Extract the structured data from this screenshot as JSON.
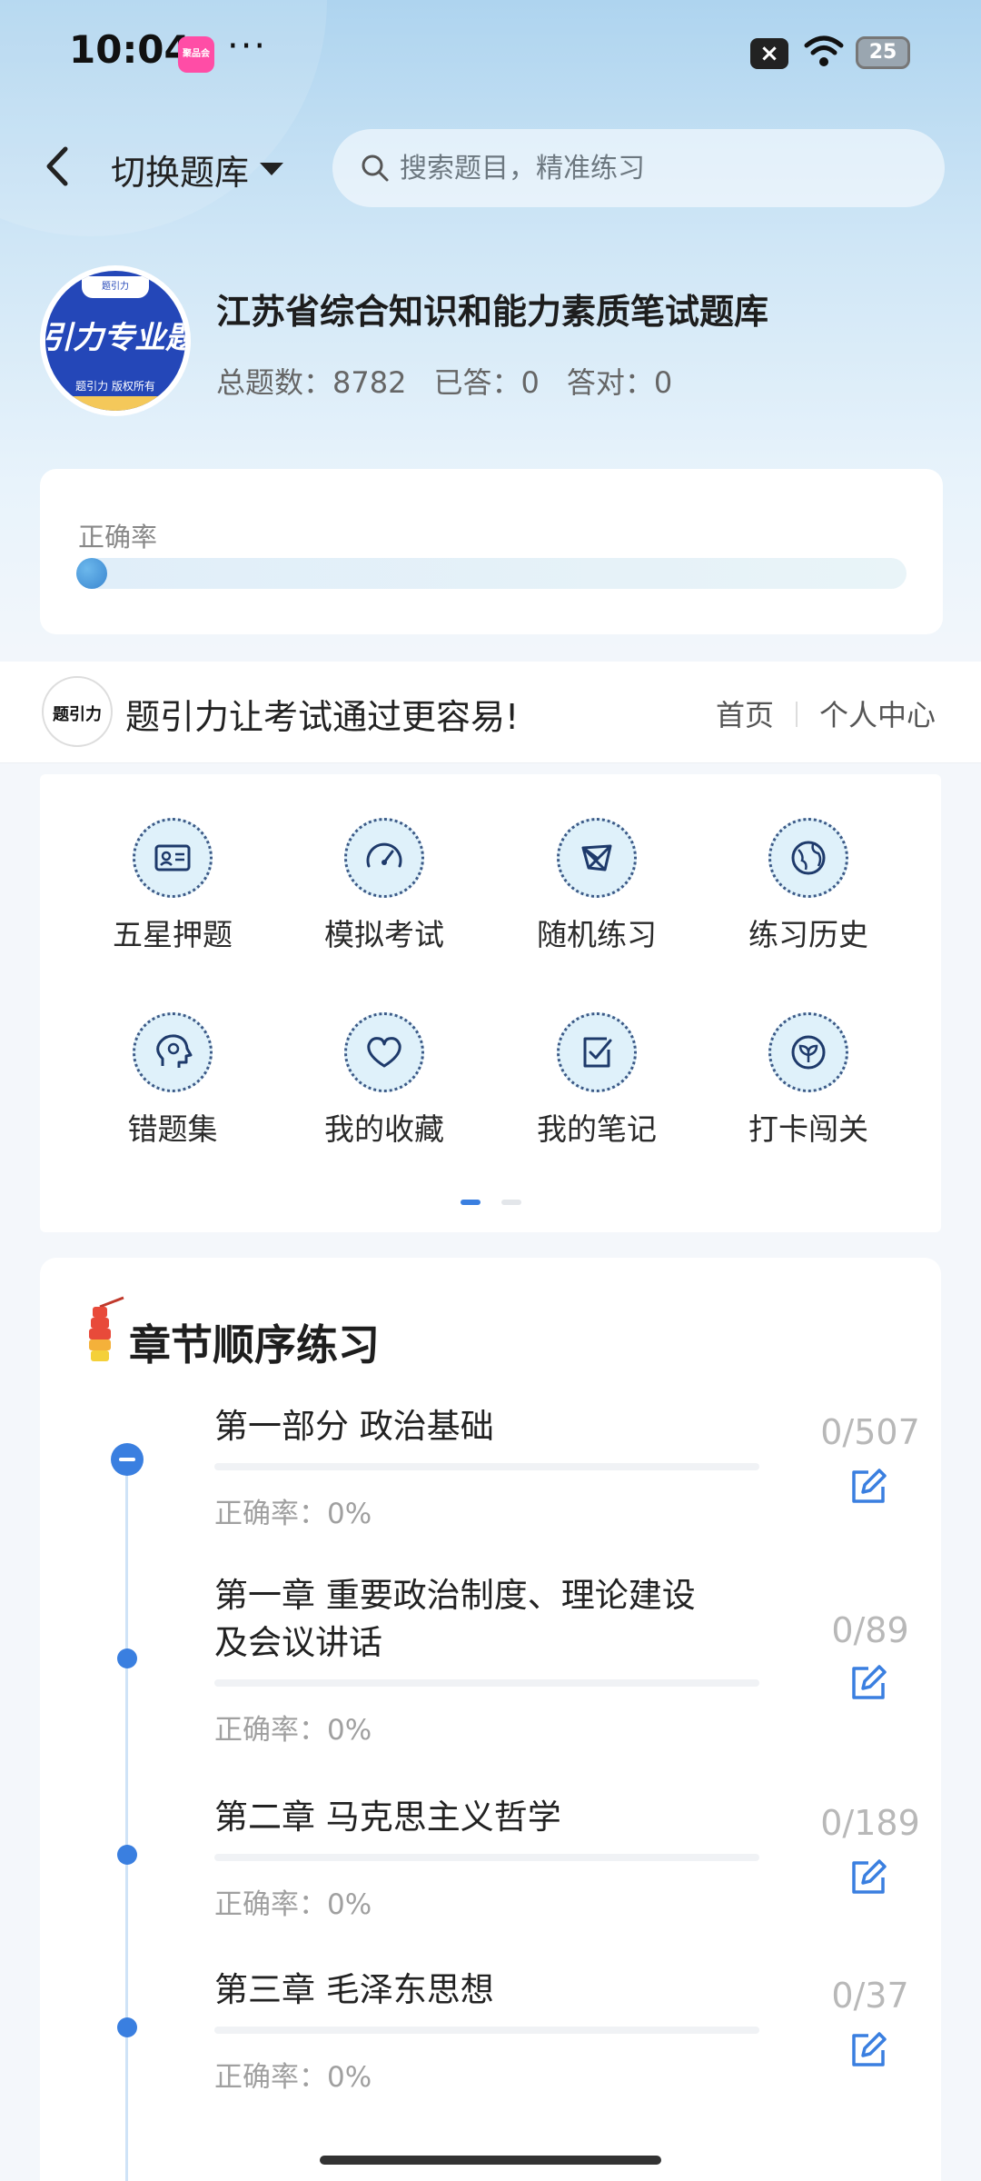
{
  "status_bar": {
    "time": "10:04",
    "app_badge": "聚品会",
    "more": "···",
    "battery": "25"
  },
  "header": {
    "switch_label": "切换题库",
    "search_placeholder": "搜索题目，精准练习"
  },
  "bank": {
    "logo_text": "引力专业题",
    "logo_sub": "题引力 版权所有",
    "title": "江苏省综合知识和能力素质笔试题库",
    "total": "总题数：8782",
    "answered": "已答：0",
    "correct": "答对：0"
  },
  "accuracy": {
    "label": "正确率",
    "value": 0
  },
  "brand": {
    "logo": "题引力",
    "slogan": "题引力让考试通过更容易!",
    "home": "首页",
    "profile": "个人中心"
  },
  "features": [
    {
      "label": "五星押题",
      "icon": "id-card-icon"
    },
    {
      "label": "模拟考试",
      "icon": "gauge-icon"
    },
    {
      "label": "随机练习",
      "icon": "network-icon"
    },
    {
      "label": "练习历史",
      "icon": "globe-icon"
    },
    {
      "label": "错题集",
      "icon": "head-icon"
    },
    {
      "label": "我的收藏",
      "icon": "heart-icon"
    },
    {
      "label": "我的笔记",
      "icon": "note-check-icon"
    },
    {
      "label": "打卡闯关",
      "icon": "sprout-icon"
    }
  ],
  "chapters": {
    "title": "章节顺序练习",
    "items": [
      {
        "name": "第一部分 政治基础",
        "rate": "正确率：0%",
        "count": "0/507"
      },
      {
        "name": "第一章 重要政治制度、理论建设及会议讲话",
        "rate": "正确率：0%",
        "count": "0/89"
      },
      {
        "name": "第二章 马克思主义哲学",
        "rate": "正确率：0%",
        "count": "0/189"
      },
      {
        "name": "第三章 毛泽东思想",
        "rate": "正确率：0%",
        "count": "0/37"
      }
    ]
  },
  "colors": {
    "accent": "#3a7fe0",
    "logo_blue": "#2447b8"
  }
}
